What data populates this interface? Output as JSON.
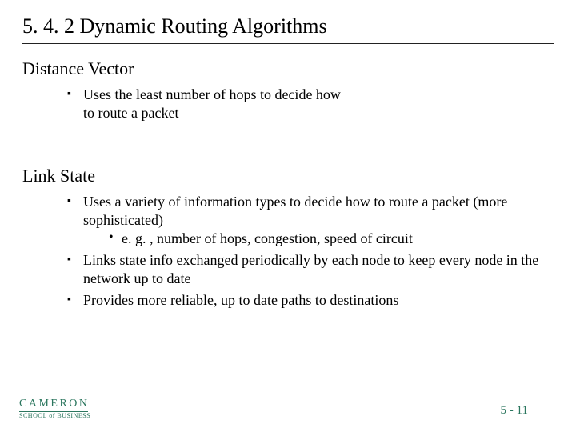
{
  "title": "5. 4. 2  Dynamic Routing Algorithms",
  "sections": [
    {
      "heading": "Distance Vector",
      "bullets": [
        {
          "text": "Uses the least number of hops to decide how to  route a packet",
          "narrow": true
        }
      ]
    },
    {
      "heading": "Link State",
      "bullets": [
        {
          "text": "Uses a variety of information types to decide how to route a packet (more sophisticated)",
          "sub": [
            "e. g. , number of hops, congestion, speed of circuit"
          ]
        },
        {
          "text": "Links state info exchanged periodically by each node to keep every node in the network up to date"
        },
        {
          "text": "Provides more reliable, up to date paths to destinations"
        }
      ]
    }
  ],
  "footer": "5 - 11",
  "logo": {
    "line1": "CAMERON",
    "line2": "SCHOOL of BUSINESS"
  }
}
